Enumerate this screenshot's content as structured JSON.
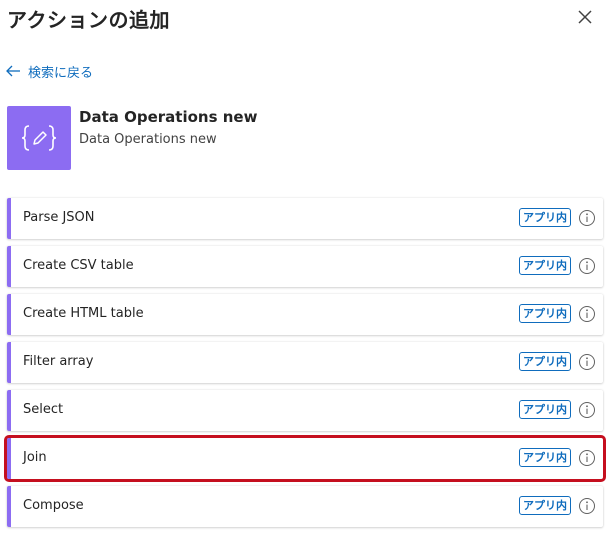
{
  "header": {
    "title": "アクションの追加",
    "close_icon": "close-icon"
  },
  "nav": {
    "back_label": "検索に戻る",
    "back_icon": "arrow-left-icon"
  },
  "connector": {
    "title": "Data Operations new",
    "subtitle": "Data Operations new",
    "icon": "curly-braces-pencil-icon",
    "icon_color": "#8c6cf2"
  },
  "actions": [
    {
      "label": "Parse JSON",
      "badge": "アプリ内",
      "selected": false
    },
    {
      "label": "Create CSV table",
      "badge": "アプリ内",
      "selected": false
    },
    {
      "label": "Create HTML table",
      "badge": "アプリ内",
      "selected": false
    },
    {
      "label": "Filter array",
      "badge": "アプリ内",
      "selected": false
    },
    {
      "label": "Select",
      "badge": "アプリ内",
      "selected": false
    },
    {
      "label": "Join",
      "badge": "アプリ内",
      "selected": true
    },
    {
      "label": "Compose",
      "badge": "アプリ内",
      "selected": false
    }
  ],
  "colors": {
    "accent": "#8c6cf2",
    "link": "#0f6cbd",
    "highlight": "#c50f1f"
  }
}
